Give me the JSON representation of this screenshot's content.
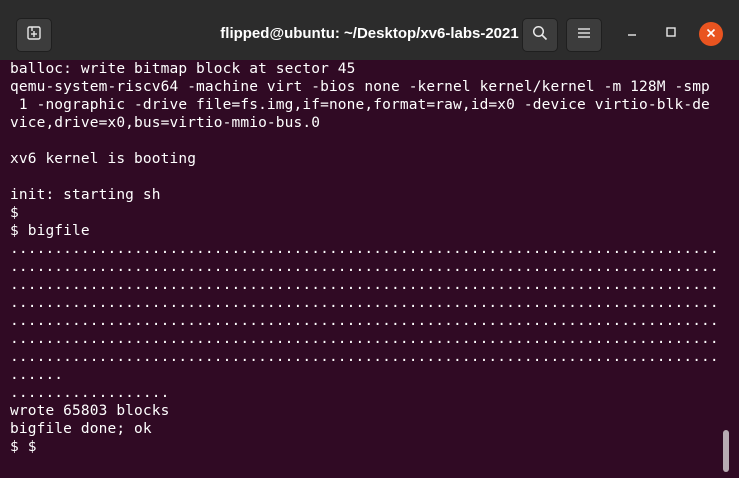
{
  "window": {
    "title": "flipped@ubuntu: ~/Desktop/xv6-labs-2021"
  },
  "header": {
    "new_tab_icon": "new-tab-icon",
    "search_icon": "search-icon",
    "menu_icon": "hamburger-menu-icon",
    "minimize_icon": "minimize-icon",
    "maximize_icon": "maximize-icon",
    "close_icon": "close-icon"
  },
  "colors": {
    "terminal_bg": "#300a24",
    "titlebar_bg": "#2c2c2c",
    "close_button": "#e95420",
    "text": "#ffffff"
  },
  "terminal": {
    "lines": [
      "balloc: write bitmap block at sector 45",
      "qemu-system-riscv64 -machine virt -bios none -kernel kernel/kernel -m 128M -smp",
      " 1 -nographic -drive file=fs.img,if=none,format=raw,id=x0 -device virtio-blk-de",
      "vice,drive=x0,bus=virtio-mmio-bus.0",
      "",
      "xv6 kernel is booting",
      "",
      "init: starting sh",
      "$",
      "$ bigfile",
      "................................................................................",
      "................................................................................",
      "................................................................................",
      "................................................................................",
      "................................................................................",
      "................................................................................",
      "................................................................................",
      "......",
      "..................",
      "wrote 65803 blocks",
      "bigfile done; ok",
      "$ $"
    ]
  }
}
